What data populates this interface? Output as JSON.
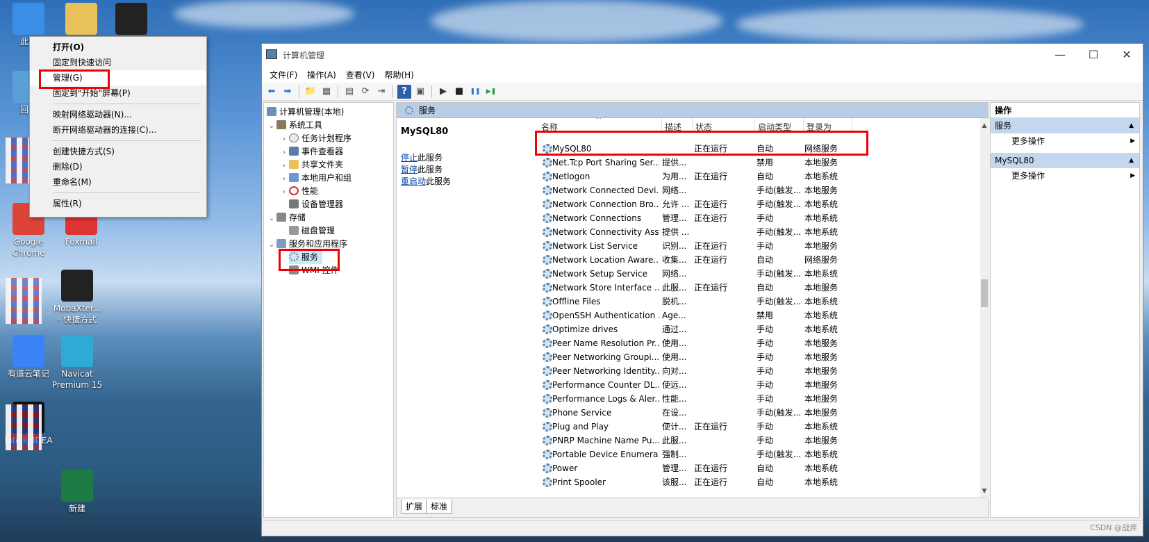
{
  "desktop": {
    "icons": [
      {
        "label": "此电",
        "color": "#3a8ee6"
      },
      {
        "label": "",
        "color": "#e8c15a"
      },
      {
        "label": "",
        "color": "#222"
      },
      {
        "label": "回收",
        "color": "#5aa0d8"
      },
      {
        "label": "Google\nChrome",
        "color": "#db4437"
      },
      {
        "label": "Foxmail",
        "color": "#d33"
      },
      {
        "label": "MobaXter...\n- 快捷方式",
        "color": "#222"
      },
      {
        "label": "有道云笔记",
        "color": "#3b82f6"
      },
      {
        "label": "Navicat\nPremium 15",
        "color": "#2fa9d6"
      },
      {
        "label": "IntelliJ IDEA",
        "color": "#111"
      },
      {
        "label": "新建",
        "color": "#1d7a45"
      }
    ]
  },
  "context_menu": {
    "items": [
      {
        "label": "打开(O)",
        "bold": true
      },
      {
        "label": "固定到快速访问"
      },
      {
        "label": "管理(G)",
        "highlight": true
      },
      {
        "label": "固定到\"开始\"屏幕(P)"
      },
      {
        "sep": true
      },
      {
        "label": "映射网络驱动器(N)..."
      },
      {
        "label": "断开网络驱动器的连接(C)..."
      },
      {
        "sep": true
      },
      {
        "label": "创建快捷方式(S)"
      },
      {
        "label": "删除(D)"
      },
      {
        "label": "重命名(M)"
      },
      {
        "sep": true
      },
      {
        "label": "属性(R)"
      }
    ]
  },
  "window": {
    "title": "计算机管理",
    "controls": {
      "minimize": "—",
      "maximize": "☐",
      "close": "✕"
    },
    "menu": [
      "文件(F)",
      "操作(A)",
      "查看(V)",
      "帮助(H)"
    ],
    "toolbar_icons": [
      "back-icon",
      "forward-icon",
      "up-folder-icon",
      "show-tree-icon",
      "properties-icon",
      "refresh-icon",
      "export-icon",
      "help-icon",
      "view-icon",
      "play-icon",
      "stop-icon",
      "pause-icon",
      "restart-icon"
    ]
  },
  "tree": {
    "root": "计算机管理(本地)",
    "system_tools": "系统工具",
    "task_scheduler": "任务计划程序",
    "event_viewer": "事件查看器",
    "shared_folders": "共享文件夹",
    "local_users": "本地用户和组",
    "performance": "性能",
    "device_manager": "设备管理器",
    "storage": "存储",
    "disk_management": "磁盘管理",
    "services_apps": "服务和应用程序",
    "services": "服务",
    "wmi": "WMI 控件"
  },
  "center": {
    "header": "服务",
    "selected_service": "MySQL80",
    "actions": [
      {
        "link": "停止",
        "text": "此服务"
      },
      {
        "link": "暂停",
        "text": "此服务"
      },
      {
        "link": "重启动",
        "text": "此服务"
      }
    ],
    "columns": [
      "名称",
      "描述",
      "状态",
      "启动类型",
      "登录为"
    ],
    "rows": [
      [
        "MySQL80",
        "",
        "正在运行",
        "自动",
        "网络服务"
      ],
      [
        "Net.Tcp Port Sharing Ser...",
        "提供...",
        "",
        "禁用",
        "本地服务"
      ],
      [
        "Netlogon",
        "为用...",
        "正在运行",
        "自动",
        "本地系统"
      ],
      [
        "Network Connected Devi...",
        "网络...",
        "",
        "手动(触发...",
        "本地服务"
      ],
      [
        "Network Connection Bro...",
        "允许 ...",
        "正在运行",
        "手动(触发...",
        "本地系统"
      ],
      [
        "Network Connections",
        "管理...",
        "正在运行",
        "手动",
        "本地系统"
      ],
      [
        "Network Connectivity Ass...",
        "提供 ...",
        "",
        "手动(触发...",
        "本地系统"
      ],
      [
        "Network List Service",
        "识别...",
        "正在运行",
        "手动",
        "本地服务"
      ],
      [
        "Network Location Aware...",
        "收集...",
        "正在运行",
        "自动",
        "网络服务"
      ],
      [
        "Network Setup Service",
        "网络...",
        "",
        "手动(触发...",
        "本地系统"
      ],
      [
        "Network Store Interface ...",
        "此服...",
        "正在运行",
        "自动",
        "本地服务"
      ],
      [
        "Offline Files",
        "脱机...",
        "",
        "手动(触发...",
        "本地系统"
      ],
      [
        "OpenSSH Authentication ...",
        "Age...",
        "",
        "禁用",
        "本地系统"
      ],
      [
        "Optimize drives",
        "通过...",
        "",
        "手动",
        "本地系统"
      ],
      [
        "Peer Name Resolution Pr...",
        "使用...",
        "",
        "手动",
        "本地服务"
      ],
      [
        "Peer Networking Groupi...",
        "使用...",
        "",
        "手动",
        "本地服务"
      ],
      [
        "Peer Networking Identity...",
        "向对...",
        "",
        "手动",
        "本地服务"
      ],
      [
        "Performance Counter DL...",
        "使远...",
        "",
        "手动",
        "本地服务"
      ],
      [
        "Performance Logs & Aler...",
        "性能...",
        "",
        "手动",
        "本地服务"
      ],
      [
        "Phone Service",
        "在设...",
        "",
        "手动(触发...",
        "本地服务"
      ],
      [
        "Plug and Play",
        "使计...",
        "正在运行",
        "手动",
        "本地系统"
      ],
      [
        "PNRP Machine Name Pu...",
        "此服...",
        "",
        "手动",
        "本地服务"
      ],
      [
        "Portable Device Enumera...",
        "强制...",
        "",
        "手动(触发...",
        "本地系统"
      ],
      [
        "Power",
        "管理...",
        "正在运行",
        "自动",
        "本地系统"
      ],
      [
        "Print Spooler",
        "该服...",
        "正在运行",
        "自动",
        "本地系统"
      ]
    ],
    "tabs": [
      "扩展",
      "标准"
    ]
  },
  "actions_panel": {
    "header": "操作",
    "group1": "服务",
    "group1_item": "更多操作",
    "group2": "MySQL80",
    "group2_item": "更多操作"
  },
  "watermark": "CSDN @战斧"
}
